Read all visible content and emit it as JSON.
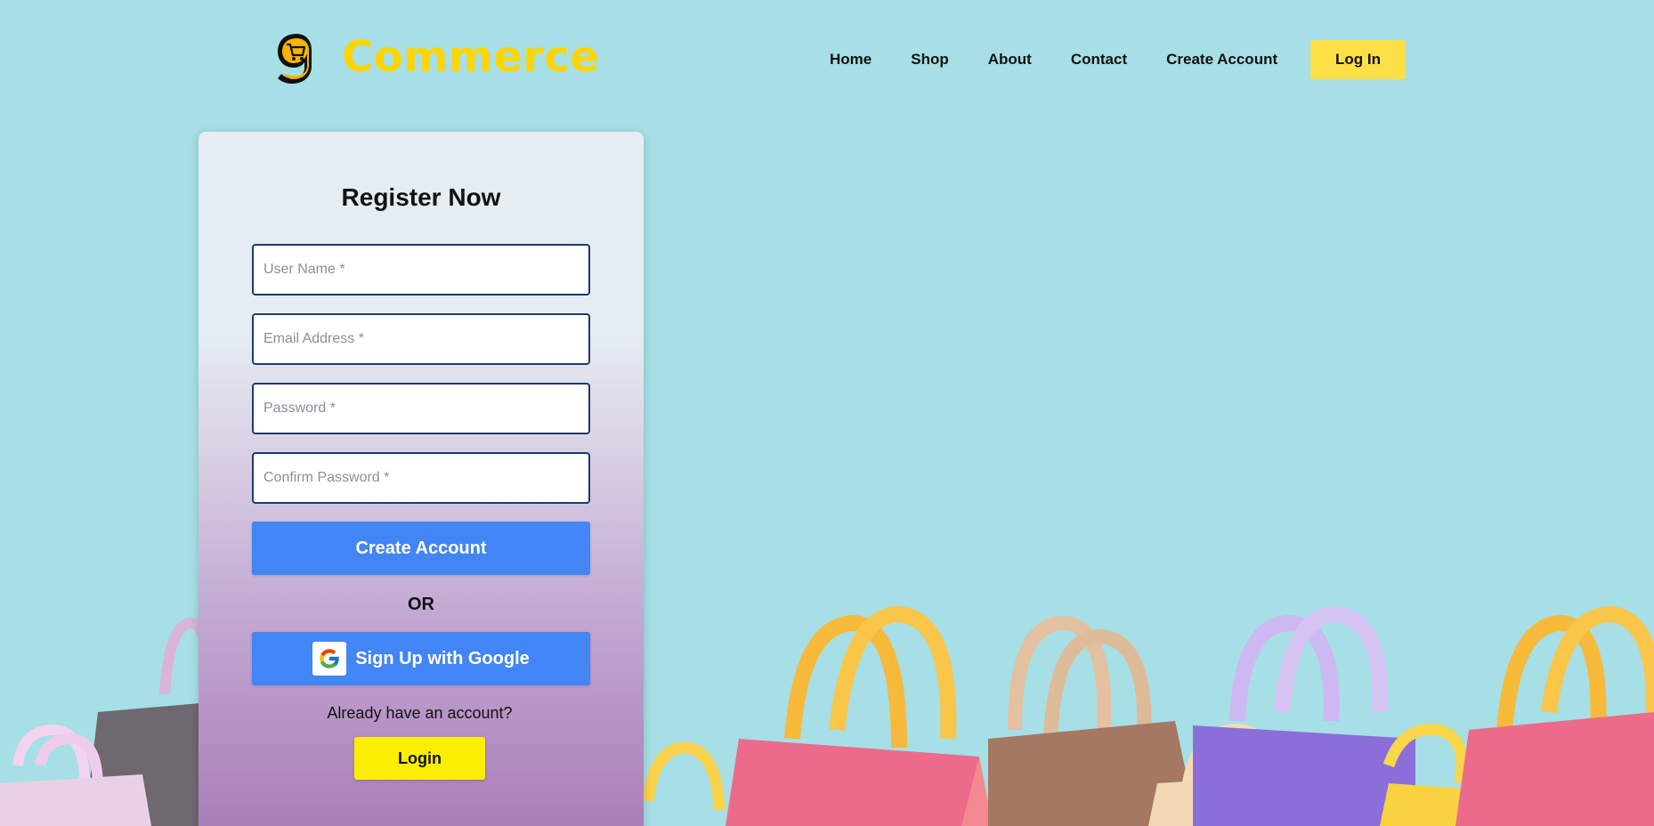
{
  "header": {
    "brand": "Commerce",
    "nav": [
      "Home",
      "Shop",
      "About",
      "Contact",
      "Create Account"
    ],
    "login_button": "Log In"
  },
  "register": {
    "title": "Register Now",
    "username_placeholder": "User Name *",
    "email_placeholder": "Email Address *",
    "password_placeholder": "Password *",
    "confirm_placeholder": "Confirm Password *",
    "create_button": "Create Account",
    "or_text": "OR",
    "google_button": "Sign Up with Google",
    "already_text": "Already have an account?",
    "login_button": "Login"
  },
  "colors": {
    "background": "#a6dfe6",
    "brand": "#ffd500",
    "primary_button": "#4285f4",
    "login_button": "#fcee00",
    "nav_login": "#fde047"
  },
  "icons": {
    "logo": "shopping-cart-logo-icon",
    "google": "google-g-icon"
  }
}
